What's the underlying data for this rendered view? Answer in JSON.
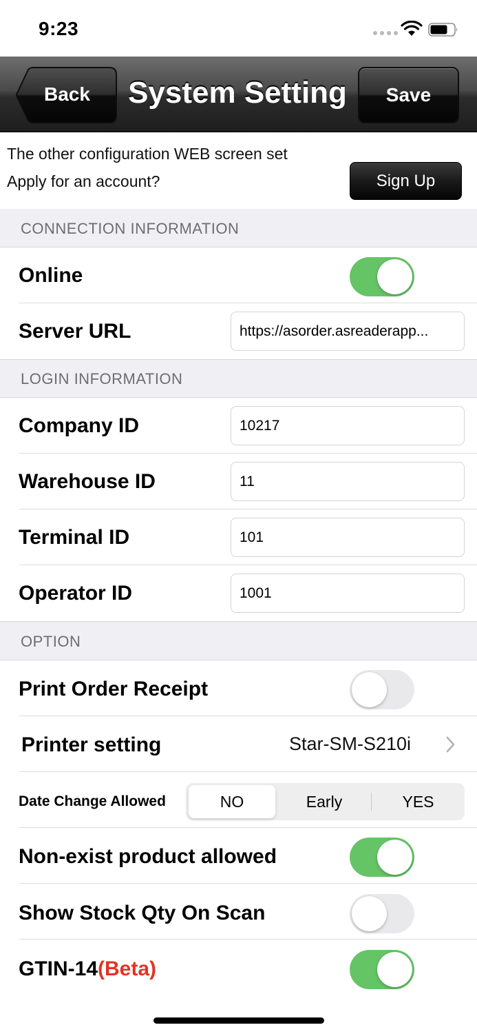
{
  "status_bar": {
    "time": "9:23"
  },
  "nav": {
    "title": "System Setting",
    "back_label": "Back",
    "save_label": "Save"
  },
  "web_config": {
    "line1": "The other configuration WEB screen set",
    "line2": "Apply for an account?",
    "signup_label": "Sign Up"
  },
  "sections": {
    "connection": "CONNECTION INFORMATION",
    "login": "LOGIN INFORMATION",
    "option": "OPTION"
  },
  "connection": {
    "online_label": "Online",
    "online_on": true,
    "server_url_label": "Server URL",
    "server_url_value": "https://asorder.asreaderapp..."
  },
  "login": {
    "company_id_label": "Company ID",
    "company_id_value": "10217",
    "warehouse_id_label": "Warehouse ID",
    "warehouse_id_value": "11",
    "terminal_id_label": "Terminal ID",
    "terminal_id_value": "101",
    "operator_id_label": "Operator ID",
    "operator_id_value": "1001"
  },
  "option": {
    "print_receipt_label": "Print Order Receipt",
    "print_receipt_on": false,
    "printer_setting_label": "Printer setting",
    "printer_setting_value": "Star-SM-S210i",
    "date_change_label": "Date Change Allowed",
    "date_change_options": [
      "NO",
      "Early",
      "YES"
    ],
    "date_change_selected": "NO",
    "nonexist_label": "Non-exist product allowed",
    "nonexist_on": true,
    "show_stock_label": "Show Stock Qty On Scan",
    "show_stock_on": false,
    "gtin_label": "GTIN-14",
    "gtin_beta": "(Beta)",
    "gtin_on": true
  },
  "colors": {
    "toggle_on": "#65c466",
    "toggle_off": "#e9e9eb",
    "beta_red": "#e03424"
  }
}
